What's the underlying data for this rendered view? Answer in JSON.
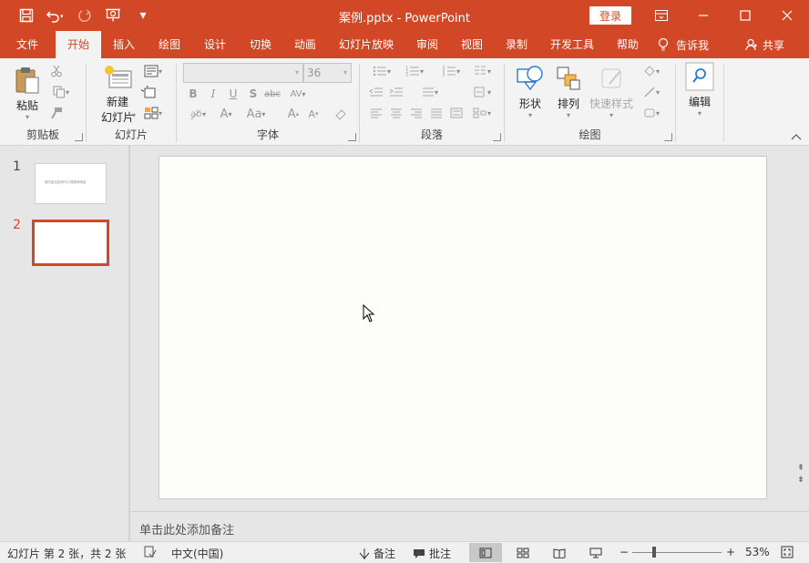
{
  "titlebar": {
    "title": "案例.pptx  -  PowerPoint",
    "login_label": "登录",
    "qat_customize": "▾"
  },
  "tabs": [
    "文件",
    "开始",
    "插入",
    "绘图",
    "设计",
    "切换",
    "动画",
    "幻灯片放映",
    "审阅",
    "视图",
    "录制",
    "开发工具",
    "帮助"
  ],
  "active_tab": "开始",
  "tellme_label": "告诉我",
  "share_label": "共享",
  "ribbon": {
    "clipboard": {
      "paste_label": "粘贴",
      "group_label": "剪贴板"
    },
    "slides": {
      "new_slide_line1": "新建",
      "new_slide_line2": "幻灯片",
      "group_label": "幻灯片"
    },
    "font": {
      "font_name": "",
      "font_size": "36",
      "group_label": "字体"
    },
    "paragraph": {
      "group_label": "段落"
    },
    "drawing": {
      "shape_label": "形状",
      "arrange_label": "排列",
      "quick_style_label": "快速样式",
      "group_label": "绘图"
    },
    "editing": {
      "edit_label": "编辑"
    }
  },
  "thumbnails": [
    {
      "number": "1",
      "caption": "第四届全国海洋大赛圆满落幕",
      "selected": false
    },
    {
      "number": "2",
      "caption": "",
      "selected": true
    }
  ],
  "notes_placeholder": "单击此处添加备注",
  "statusbar": {
    "slide_info": "幻灯片 第 2 张，共 2 张",
    "language": "中文(中国)",
    "notes_label": "备注",
    "comments_label": "批注",
    "zoom_minus": "−",
    "zoom_plus": "+",
    "zoom_level": "53%"
  },
  "colors": {
    "accent": "#d24726",
    "ribbon_bg": "#f3f3f3",
    "workspace_bg": "#e6e6e6"
  }
}
